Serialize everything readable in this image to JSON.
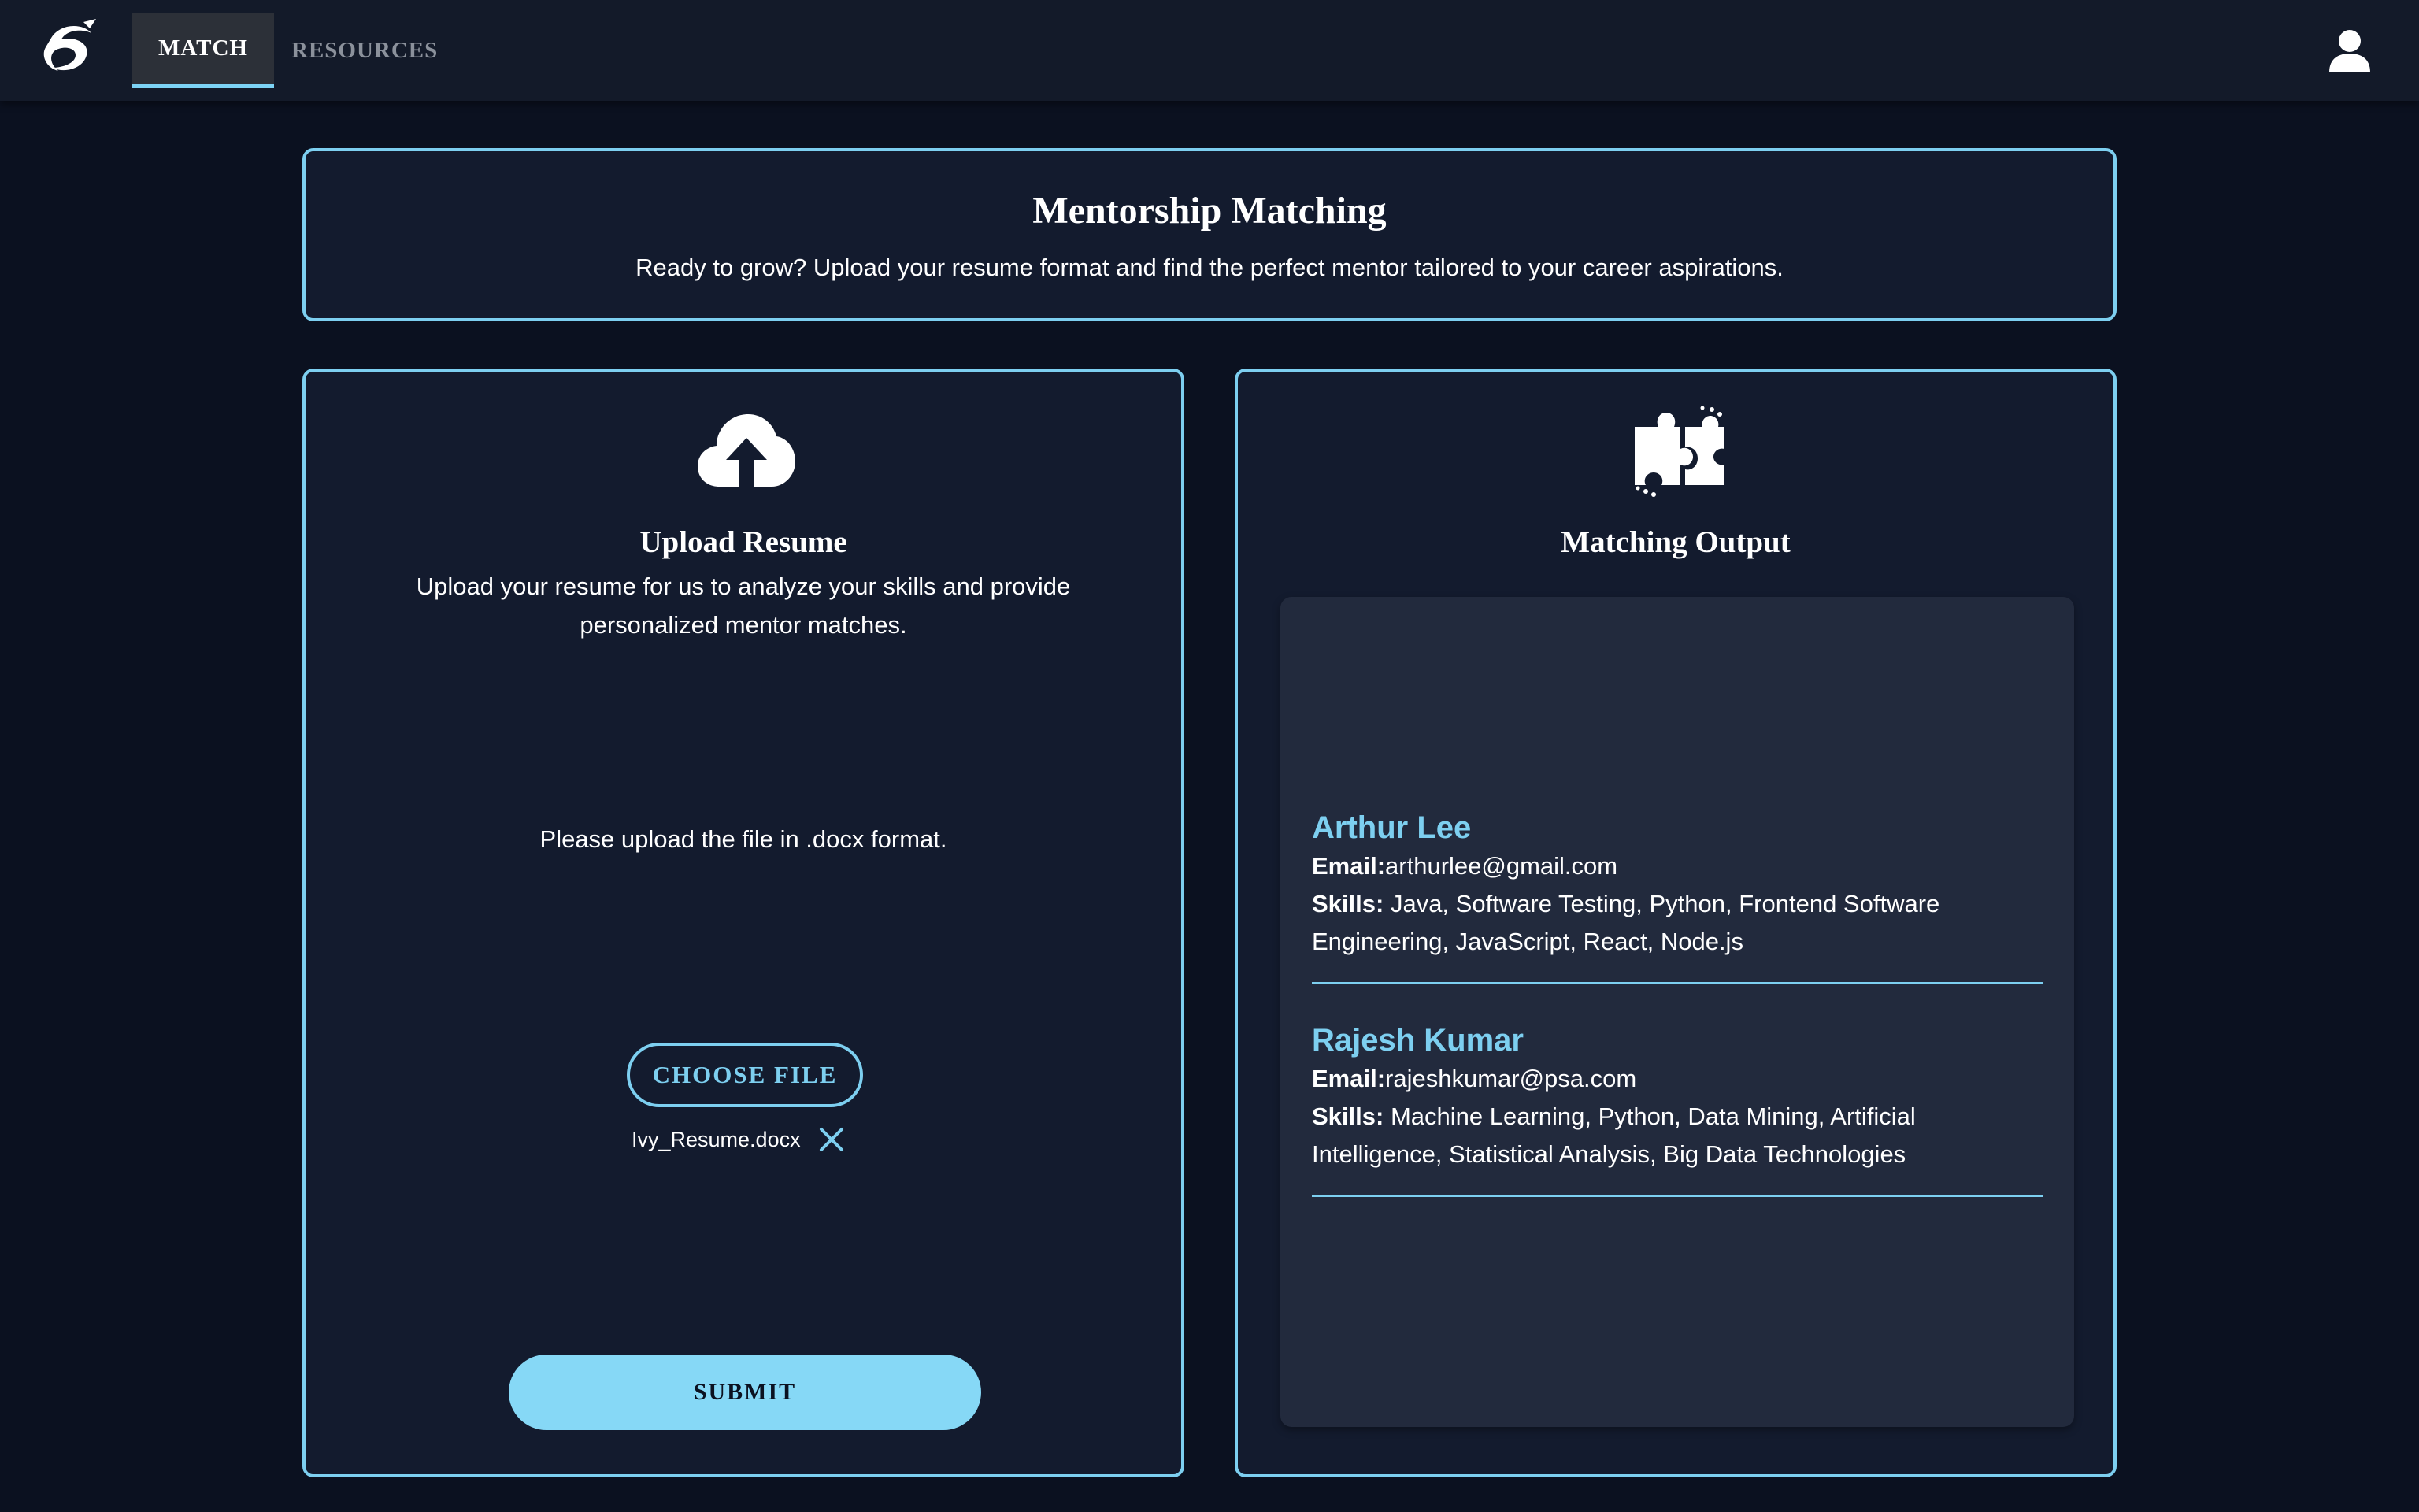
{
  "nav": {
    "tabs": [
      {
        "label": "MATCH",
        "active": true
      },
      {
        "label": "RESOURCES",
        "active": false
      }
    ]
  },
  "header": {
    "title": "Mentorship Matching",
    "subtitle": "Ready to grow? Upload your resume format and find the perfect mentor tailored to your career aspirations."
  },
  "upload": {
    "icon": "cloud-upload-icon",
    "title": "Upload Resume",
    "description": "Upload your resume for us to analyze your skills and provide personalized mentor matches.",
    "note": "Please upload the file in .docx format.",
    "choose_label": "CHOOSE FILE",
    "file_name": "Ivy_Resume.docx",
    "submit_label": "SUBMIT"
  },
  "output": {
    "icon": "puzzle-icon",
    "title": "Matching Output",
    "email_label": "Email:",
    "skills_label": "Skills:",
    "mentors": [
      {
        "name": "Arthur Lee",
        "email": "arthurlee@gmail.com",
        "skills": "Java, Software Testing, Python, Frontend Software Engineering, JavaScript, React, Node.js"
      },
      {
        "name": "Rajesh Kumar",
        "email": "rajeshkumar@psa.com",
        "skills": "Machine Learning, Python, Data Mining, Artificial Intelligence, Statistical Analysis, Big Data Technologies"
      }
    ]
  },
  "colors": {
    "accent": "#7dcff0",
    "background": "#0b1120",
    "card": "#131b2e",
    "submit": "#86d8f6"
  }
}
